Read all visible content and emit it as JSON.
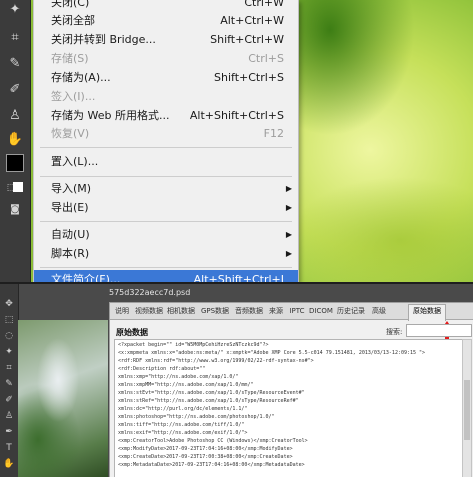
{
  "file_menu": {
    "items": [
      {
        "label": "关闭(C)",
        "shortcut": "Ctrl+W",
        "disabled": false,
        "submenu": false
      },
      {
        "label": "关闭全部",
        "shortcut": "Alt+Ctrl+W",
        "disabled": false,
        "submenu": false
      },
      {
        "label": "关闭并转到 Bridge...",
        "shortcut": "Shift+Ctrl+W",
        "disabled": false,
        "submenu": false
      },
      {
        "label": "存储(S)",
        "shortcut": "Ctrl+S",
        "disabled": true,
        "submenu": false
      },
      {
        "label": "存储为(A)...",
        "shortcut": "Shift+Ctrl+S",
        "disabled": false,
        "submenu": false
      },
      {
        "label": "签入(I)...",
        "shortcut": "",
        "disabled": true,
        "submenu": false
      },
      {
        "label": "存储为 Web 所用格式...",
        "shortcut": "Alt+Shift+Ctrl+S",
        "disabled": false,
        "submenu": false
      },
      {
        "label": "恢复(V)",
        "shortcut": "F12",
        "disabled": true,
        "submenu": false
      },
      {
        "label": "置入(L)...",
        "shortcut": "",
        "disabled": false,
        "submenu": false
      },
      {
        "label": "导入(M)",
        "shortcut": "",
        "disabled": false,
        "submenu": true
      },
      {
        "label": "导出(E)",
        "shortcut": "",
        "disabled": false,
        "submenu": true
      },
      {
        "label": "自动(U)",
        "shortcut": "",
        "disabled": false,
        "submenu": true
      },
      {
        "label": "脚本(R)",
        "shortcut": "",
        "disabled": false,
        "submenu": true
      },
      {
        "label": "文件简介(F)...",
        "shortcut": "Alt+Shift+Ctrl+I",
        "disabled": false,
        "submenu": false,
        "highlighted": true
      }
    ]
  },
  "toolbar_icons": [
    "wand-icon",
    "crop-icon",
    "eyedropper-icon",
    "brush-icon",
    "stamp-icon",
    "eraser-icon",
    "pen-icon",
    "hand-icon"
  ],
  "file_info_dialog": {
    "document_title": "575d322aecc7d.psd",
    "tabs": [
      "说明",
      "视频数据",
      "相机数据",
      "GPS数据",
      "音频数据",
      "来源",
      "IPTC",
      "DICOM",
      "历史记录",
      "高级",
      "原始数据"
    ],
    "active_tab": "原始数据",
    "section_title": "原始数据",
    "search_label": "搜索:",
    "search_value": "",
    "xml_lines": [
      "<?xpacket begin=\"\" id=\"W5M0MpCehiHzreSzNTczkc9d\"?>",
      "<x:xmpmeta xmlns:x=\"adobe:ns:meta/\" x:xmptk=\"Adobe XMP Core 5.5-c014 79.151481, 2013/03/13-12:09:15        \">",
      "   <rdf:RDF xmlns:rdf=\"http://www.w3.org/1999/02/22-rdf-syntax-ns#\">",
      "      <rdf:Description rdf:about=\"\"",
      "            xmlns:xmp=\"http://ns.adobe.com/xap/1.0/\"",
      "            xmlns:xmpMM=\"http://ns.adobe.com/xap/1.0/mm/\"",
      "            xmlns:stEvt=\"http://ns.adobe.com/xap/1.0/sType/ResourceEvent#\"",
      "            xmlns:stRef=\"http://ns.adobe.com/xap/1.0/sType/ResourceRef#\"",
      "            xmlns:dc=\"http://purl.org/dc/elements/1.1/\"",
      "            xmlns:photoshop=\"http://ns.adobe.com/photoshop/1.0/\"",
      "            xmlns:tiff=\"http://ns.adobe.com/tiff/1.0/\"",
      "            xmlns:exif=\"http://ns.adobe.com/exif/1.0/\">",
      "         <xmp:CreatorTool>Adobe Photoshop CC (Windows)</xmp:CreatorTool>",
      "         <xmp:ModifyDate>2017-09-23T17:04:16+08:00</xmp:ModifyDate>",
      "         <xmp:CreateDate>2017-09-23T17:00:38+08:00</xmp:CreateDate>",
      "         <xmp:MetadataDate>2017-09-23T17:04:16+08:00</xmp:MetadataDate>"
    ]
  },
  "colors": {
    "menu_highlight": "#3b78d6",
    "menu_background": "#f0f0f0",
    "arrow": "#e21b1b"
  }
}
